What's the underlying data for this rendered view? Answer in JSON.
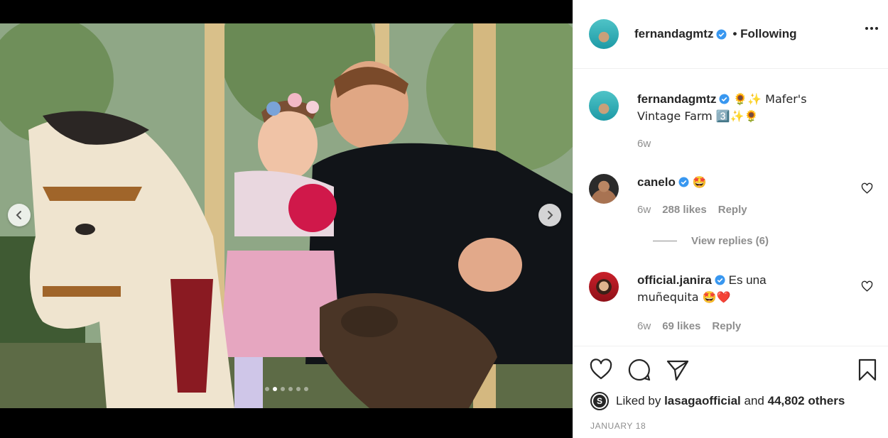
{
  "post": {
    "author": "fernandagmtz",
    "follow_status": "Following",
    "caption_username": "fernandagmtz",
    "caption_text_1": "🌻✨ Mafer's",
    "caption_text_2": "Vintage Farm 3️⃣✨🌻",
    "caption_time": "6w",
    "image_label": "Girl and man on carousel horse",
    "carousel_dots": 6,
    "carousel_active": 1
  },
  "comments": [
    {
      "username": "canelo",
      "text": "🤩",
      "time": "6w",
      "likes": "288 likes",
      "reply": "Reply",
      "view_replies": "View replies (6)"
    },
    {
      "username": "official.janira",
      "text_1": "Es una",
      "text_2": "muñequita 🤩❤️",
      "time": "6w",
      "likes": "69 likes",
      "reply": "Reply"
    }
  ],
  "actions": {
    "like_icon": "heart-icon",
    "comment_icon": "comment-icon",
    "share_icon": "paper-plane-icon",
    "save_icon": "bookmark-icon"
  },
  "likes": {
    "prefix": "Liked by",
    "user": "lasagaofficial",
    "and": "and",
    "others": "44,802 others",
    "avatar_letter": "S"
  },
  "date": "JANUARY 18",
  "colors": {
    "verified": "#3897f0",
    "text": "#262626",
    "muted": "#8e8e8e",
    "heart_red": "#ed4956"
  }
}
